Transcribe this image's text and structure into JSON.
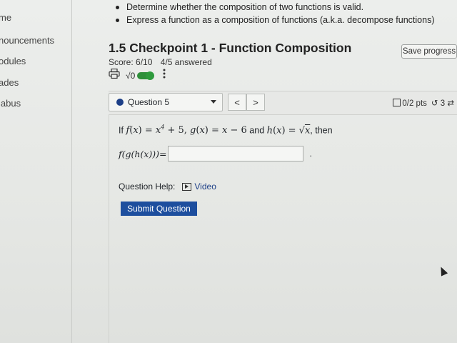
{
  "sidebar": {
    "items": [
      {
        "label": "me"
      },
      {
        "label": "nouncements"
      },
      {
        "label": "odules"
      },
      {
        "label": "ades"
      },
      {
        "label": "labus"
      }
    ]
  },
  "objectives": [
    "Determine whether the composition of two functions is valid.",
    "Express a function as a composition of functions (a.k.a. decompose functions)"
  ],
  "assignment": {
    "title": "1.5 Checkpoint 1 - Function Composition",
    "save_label": "Save progress",
    "score": "Score: 6/10",
    "answered": "4/5 answered",
    "toggle_label": "√0"
  },
  "question_bar": {
    "selected": "Question 5",
    "prev_label": "<",
    "next_label": ">",
    "points": "0/2 pts",
    "attempts": "3"
  },
  "question": {
    "stem_if": "If",
    "stem_and": "and",
    "stem_then": ", then",
    "answer_label": "f(g(h(x)))=",
    "period": ".",
    "help_label": "Question Help:",
    "video_label": "Video",
    "submit_label": "Submit Question"
  },
  "colors": {
    "accent": "#1d4e9e",
    "toggle": "#2e9a3c",
    "dot": "#1d3f87"
  }
}
